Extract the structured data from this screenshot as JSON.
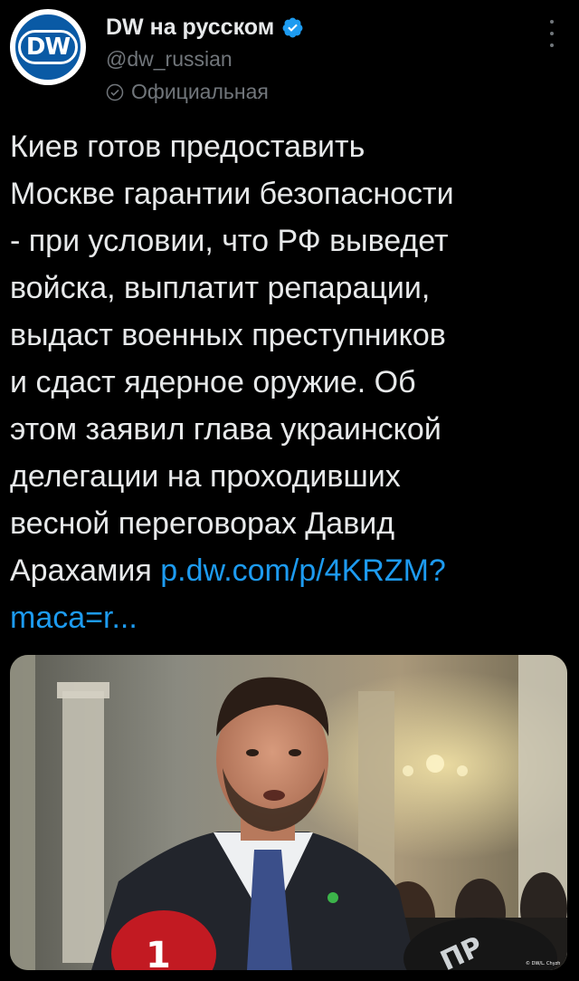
{
  "account": {
    "avatar_text": "DW",
    "display_name": "DW на русском",
    "handle": "@dw_russian",
    "official_label": "Официальная"
  },
  "tweet": {
    "text": "Киев готов предоставить\nМоскве гарантии безопасности\n- при условии, что РФ выведет\nвойска, выплатит репарации,\nвыдаст военных преступников\nи сдаст ядерное оружие. Об\nэтом заявил глава украинской\nделегации на проходивших\nвесной переговорах Давид\nАрахамия ",
    "link": "p.dw.com/p/4KRZM?\nmaca=r..."
  },
  "media": {
    "alt": "",
    "watermark": "© DW/L. Chyzh",
    "mic_letters": "ПР"
  },
  "colors": {
    "background": "#000000",
    "text": "#e7e9ea",
    "secondary": "#71767b",
    "link": "#1d9bf0",
    "verified": "#1d9bf0",
    "dw_blue": "#0a5aa5"
  }
}
